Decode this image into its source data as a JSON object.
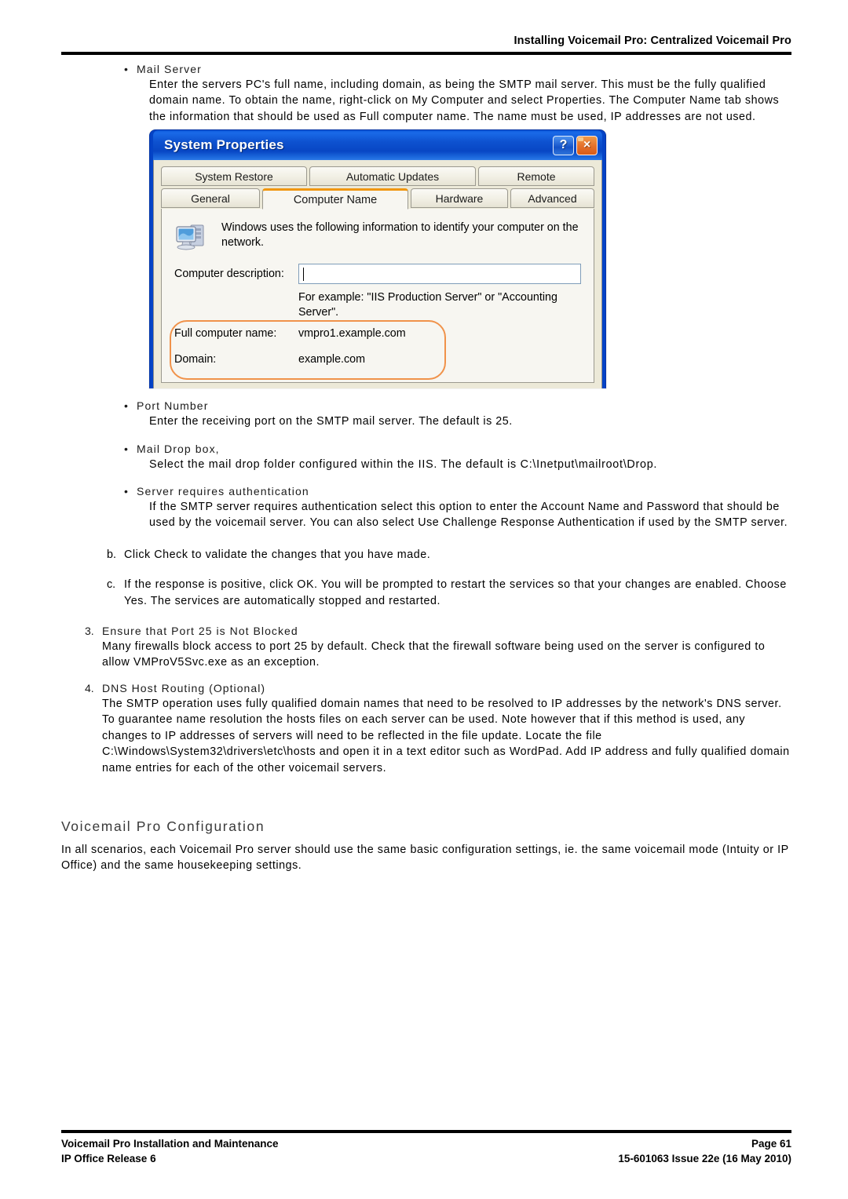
{
  "header": {
    "title": "Installing Voicemail Pro: Centralized Voicemail Pro"
  },
  "bullets": [
    {
      "marker": "•",
      "heading": "Mail Server",
      "body": "Enter the servers PC's full name, including domain, as being the SMTP mail server. This must be the fully qualified domain name. To obtain the name, right-click on My Computer and select Properties. The Computer Name tab shows the information that should be used as Full computer name. The name must be used, IP addresses are not used."
    },
    {
      "marker": "•",
      "heading": "Port Number",
      "body": "Enter the receiving port on the SMTP mail server. The default is 25."
    },
    {
      "marker": "•",
      "heading": "Mail Drop box,",
      "body": "Select the mail drop folder configured within the IIS. The default is C:\\Inetput\\mailroot\\Drop."
    },
    {
      "marker": "•",
      "heading": "Server requires authentication",
      "body": "If the SMTP server requires authentication select this option to enter the Account Name and Password that should be used by the voicemail server. You can also select Use Challenge Response Authentication if used by the SMTP server."
    }
  ],
  "dialog": {
    "title": "System Properties",
    "help_button": "?",
    "close_button": "×",
    "tabs_row1": [
      {
        "label": "System Restore",
        "active": false
      },
      {
        "label": "Automatic Updates",
        "active": false
      },
      {
        "label": "Remote",
        "active": false
      }
    ],
    "tabs_row2": [
      {
        "label": "General",
        "active": false
      },
      {
        "label": "Computer Name",
        "active": true
      },
      {
        "label": "Hardware",
        "active": false
      },
      {
        "label": "Advanced",
        "active": false
      }
    ],
    "intro_text": "Windows uses the following information to identify your computer on the network.",
    "description_label": "Computer description:",
    "description_value": "",
    "description_hint": "For example: \"IIS Production Server\" or \"Accounting Server\".",
    "full_name_label": "Full computer name:",
    "full_name_value": "vmpro1.example.com",
    "domain_label": "Domain:",
    "domain_value": "example.com",
    "accent_color": "#f0960f",
    "annotation_color": "#f0924a",
    "titlebar_color": "#0d51cf"
  },
  "letter_items": [
    {
      "mark": "b.",
      "text": "Click Check to validate the changes that you have made."
    },
    {
      "mark": "c.",
      "text": "If the response is positive, click OK. You will be prompted to restart the services so that your changes are enabled. Choose Yes. The services are automatically stopped and restarted."
    }
  ],
  "numbered_items": [
    {
      "mark": "3.",
      "heading": "Ensure that Port 25 is Not Blocked",
      "body": "Many firewalls block access to port 25 by default. Check that the firewall software being used on the server is configured to allow VMProV5Svc.exe as an exception."
    },
    {
      "mark": "4.",
      "heading": "DNS Host Routing (Optional)",
      "body": "The SMTP operation uses fully qualified domain names that need to be resolved to IP addresses by the network's DNS server. To guarantee name resolution the hosts files on each server can be used. Note however that if this method is used, any changes to IP addresses of servers will need to be reflected in the file update. Locate the file C:\\Windows\\System32\\drivers\\etc\\hosts and open it in a text editor such as WordPad. Add IP address and fully qualified domain name entries for each of the other voicemail servers."
    }
  ],
  "section": {
    "heading": "Voicemail Pro Configuration",
    "body": "In all scenarios, each Voicemail Pro server should use the same basic configuration settings, ie. the same voicemail mode (Intuity or IP Office) and the same housekeeping settings."
  },
  "footer": {
    "left_line1": "Voicemail Pro Installation and Maintenance",
    "left_line2": "IP Office Release 6",
    "right_line1": "Page 61",
    "right_line2": "15-601063 Issue 22e (16 May 2010)"
  }
}
